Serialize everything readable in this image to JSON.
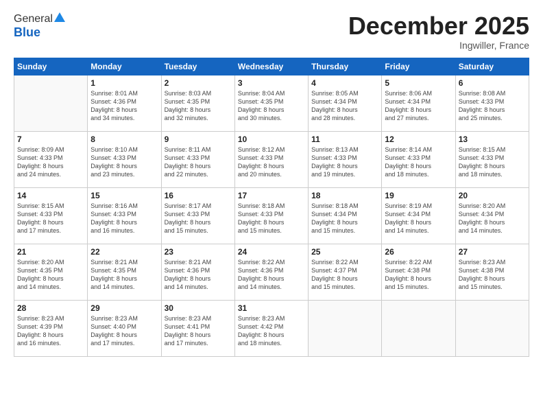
{
  "logo": {
    "line1": "General",
    "line2": "Blue"
  },
  "title": {
    "month_year": "December 2025",
    "location": "Ingwiller, France"
  },
  "headers": [
    "Sunday",
    "Monday",
    "Tuesday",
    "Wednesday",
    "Thursday",
    "Friday",
    "Saturday"
  ],
  "weeks": [
    [
      {
        "day": "",
        "detail": ""
      },
      {
        "day": "1",
        "detail": "Sunrise: 8:01 AM\nSunset: 4:36 PM\nDaylight: 8 hours\nand 34 minutes."
      },
      {
        "day": "2",
        "detail": "Sunrise: 8:03 AM\nSunset: 4:35 PM\nDaylight: 8 hours\nand 32 minutes."
      },
      {
        "day": "3",
        "detail": "Sunrise: 8:04 AM\nSunset: 4:35 PM\nDaylight: 8 hours\nand 30 minutes."
      },
      {
        "day": "4",
        "detail": "Sunrise: 8:05 AM\nSunset: 4:34 PM\nDaylight: 8 hours\nand 28 minutes."
      },
      {
        "day": "5",
        "detail": "Sunrise: 8:06 AM\nSunset: 4:34 PM\nDaylight: 8 hours\nand 27 minutes."
      },
      {
        "day": "6",
        "detail": "Sunrise: 8:08 AM\nSunset: 4:33 PM\nDaylight: 8 hours\nand 25 minutes."
      }
    ],
    [
      {
        "day": "7",
        "detail": "Sunrise: 8:09 AM\nSunset: 4:33 PM\nDaylight: 8 hours\nand 24 minutes."
      },
      {
        "day": "8",
        "detail": "Sunrise: 8:10 AM\nSunset: 4:33 PM\nDaylight: 8 hours\nand 23 minutes."
      },
      {
        "day": "9",
        "detail": "Sunrise: 8:11 AM\nSunset: 4:33 PM\nDaylight: 8 hours\nand 22 minutes."
      },
      {
        "day": "10",
        "detail": "Sunrise: 8:12 AM\nSunset: 4:33 PM\nDaylight: 8 hours\nand 20 minutes."
      },
      {
        "day": "11",
        "detail": "Sunrise: 8:13 AM\nSunset: 4:33 PM\nDaylight: 8 hours\nand 19 minutes."
      },
      {
        "day": "12",
        "detail": "Sunrise: 8:14 AM\nSunset: 4:33 PM\nDaylight: 8 hours\nand 18 minutes."
      },
      {
        "day": "13",
        "detail": "Sunrise: 8:15 AM\nSunset: 4:33 PM\nDaylight: 8 hours\nand 18 minutes."
      }
    ],
    [
      {
        "day": "14",
        "detail": "Sunrise: 8:15 AM\nSunset: 4:33 PM\nDaylight: 8 hours\nand 17 minutes."
      },
      {
        "day": "15",
        "detail": "Sunrise: 8:16 AM\nSunset: 4:33 PM\nDaylight: 8 hours\nand 16 minutes."
      },
      {
        "day": "16",
        "detail": "Sunrise: 8:17 AM\nSunset: 4:33 PM\nDaylight: 8 hours\nand 15 minutes."
      },
      {
        "day": "17",
        "detail": "Sunrise: 8:18 AM\nSunset: 4:33 PM\nDaylight: 8 hours\nand 15 minutes."
      },
      {
        "day": "18",
        "detail": "Sunrise: 8:18 AM\nSunset: 4:34 PM\nDaylight: 8 hours\nand 15 minutes."
      },
      {
        "day": "19",
        "detail": "Sunrise: 8:19 AM\nSunset: 4:34 PM\nDaylight: 8 hours\nand 14 minutes."
      },
      {
        "day": "20",
        "detail": "Sunrise: 8:20 AM\nSunset: 4:34 PM\nDaylight: 8 hours\nand 14 minutes."
      }
    ],
    [
      {
        "day": "21",
        "detail": "Sunrise: 8:20 AM\nSunset: 4:35 PM\nDaylight: 8 hours\nand 14 minutes."
      },
      {
        "day": "22",
        "detail": "Sunrise: 8:21 AM\nSunset: 4:35 PM\nDaylight: 8 hours\nand 14 minutes."
      },
      {
        "day": "23",
        "detail": "Sunrise: 8:21 AM\nSunset: 4:36 PM\nDaylight: 8 hours\nand 14 minutes."
      },
      {
        "day": "24",
        "detail": "Sunrise: 8:22 AM\nSunset: 4:36 PM\nDaylight: 8 hours\nand 14 minutes."
      },
      {
        "day": "25",
        "detail": "Sunrise: 8:22 AM\nSunset: 4:37 PM\nDaylight: 8 hours\nand 15 minutes."
      },
      {
        "day": "26",
        "detail": "Sunrise: 8:22 AM\nSunset: 4:38 PM\nDaylight: 8 hours\nand 15 minutes."
      },
      {
        "day": "27",
        "detail": "Sunrise: 8:23 AM\nSunset: 4:38 PM\nDaylight: 8 hours\nand 15 minutes."
      }
    ],
    [
      {
        "day": "28",
        "detail": "Sunrise: 8:23 AM\nSunset: 4:39 PM\nDaylight: 8 hours\nand 16 minutes."
      },
      {
        "day": "29",
        "detail": "Sunrise: 8:23 AM\nSunset: 4:40 PM\nDaylight: 8 hours\nand 17 minutes."
      },
      {
        "day": "30",
        "detail": "Sunrise: 8:23 AM\nSunset: 4:41 PM\nDaylight: 8 hours\nand 17 minutes."
      },
      {
        "day": "31",
        "detail": "Sunrise: 8:23 AM\nSunset: 4:42 PM\nDaylight: 8 hours\nand 18 minutes."
      },
      {
        "day": "",
        "detail": ""
      },
      {
        "day": "",
        "detail": ""
      },
      {
        "day": "",
        "detail": ""
      }
    ]
  ]
}
